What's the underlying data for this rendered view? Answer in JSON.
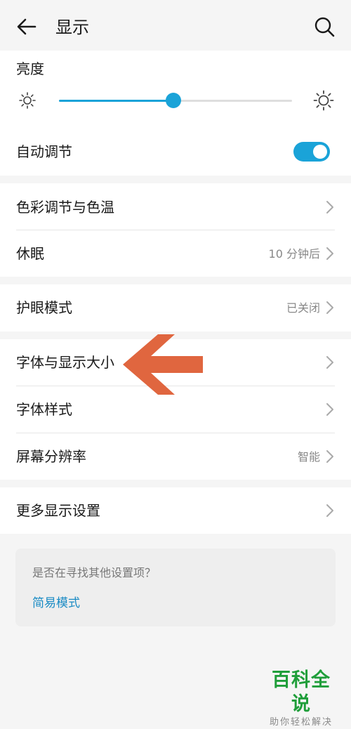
{
  "header": {
    "title": "显示"
  },
  "brightness": {
    "title": "亮度",
    "level_percent": 49,
    "auto_adjust_label": "自动调节",
    "auto_adjust_on": true
  },
  "colors": {
    "accent": "#1aa3d8",
    "link": "#1a8bc4",
    "arrow": "#e0663f",
    "watermark": "#1f9e3a"
  },
  "groups": [
    {
      "items": [
        {
          "label": "色彩调节与色温",
          "value": ""
        },
        {
          "label": "休眠",
          "value": "10 分钟后"
        }
      ]
    },
    {
      "items": [
        {
          "label": "护眼模式",
          "value": "已关闭"
        }
      ]
    },
    {
      "items": [
        {
          "label": "字体与显示大小",
          "value": ""
        },
        {
          "label": "字体样式",
          "value": ""
        },
        {
          "label": "屏幕分辨率",
          "value": "智能"
        }
      ]
    },
    {
      "items": [
        {
          "label": "更多显示设置",
          "value": ""
        }
      ]
    }
  ],
  "help": {
    "question": "是否在寻找其他设置项？",
    "link": "简易模式"
  },
  "watermark": {
    "title": "百科全说",
    "subtitle": "助你轻松解决"
  },
  "icons": {
    "back": "arrow-left-icon",
    "search": "search-icon",
    "brightness_low": "sun-small-icon",
    "brightness_high": "sun-large-icon",
    "chevron": "chevron-right-icon",
    "annotation": "arrow-left-annotation"
  }
}
